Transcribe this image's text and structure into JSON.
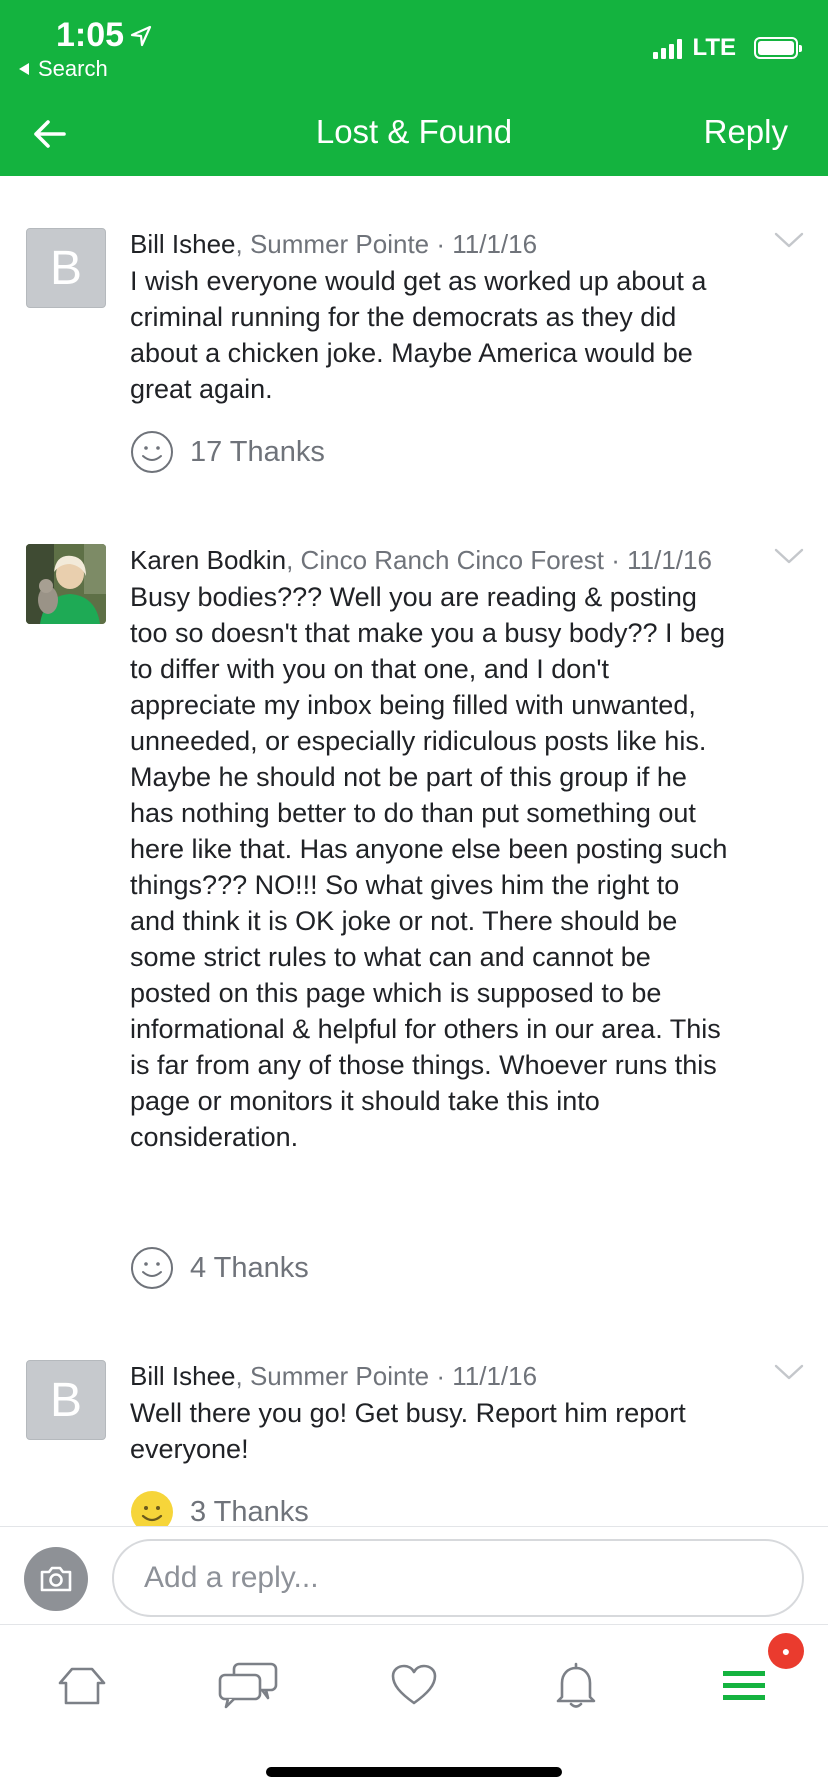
{
  "status_bar": {
    "time": "1:05",
    "back_app": "Search",
    "network": "LTE"
  },
  "nav": {
    "title": "Lost & Found",
    "reply_label": "Reply"
  },
  "comments": [
    {
      "avatar_letter": "B",
      "author": "Bill Ishee",
      "neighborhood": ", Summer Pointe · 11/1/16",
      "text": "I wish everyone would get as worked up about a criminal running for the democrats as they did about a chicken joke. Maybe America would be great again.",
      "thanks": "17 Thanks"
    },
    {
      "avatar_letter": "",
      "author": "Karen Bodkin",
      "neighborhood": ", Cinco Ranch Cinco Forest · 11/1/16",
      "text": "Busy bodies???  Well you are reading & posting too so doesn't that make you a busy body??  I beg to differ with you on that one, and I don't appreciate my inbox being filled with unwanted, unneeded, or especially ridiculous posts like his.  Maybe he should not be part of this group if he has nothing better to do than put something out here like that.  Has anyone else been posting such things??? NO!!!  So what gives him the right to and think it is OK joke or not.  There should be some strict rules to what can and cannot be posted on this page which is supposed to be informational & helpful for others in our area.  This is far from any of those things.  Whoever runs this page or monitors it should take this into consideration.",
      "thanks": "4 Thanks"
    },
    {
      "avatar_letter": "B",
      "author": "Bill Ishee",
      "neighborhood": ", Summer Pointe · 11/1/16",
      "text": "Well there you go! Get busy. Report him report everyone!",
      "thanks": "3 Thanks"
    }
  ],
  "reply_bar": {
    "placeholder": "Add a reply..."
  },
  "tab_bar": {
    "icons": [
      "home-icon",
      "messages-icon",
      "heart-icon",
      "bell-icon",
      "menu-icon"
    ]
  },
  "colors": {
    "brand_green": "#14b33f",
    "badge_red": "#ea3b2e",
    "thanked_yellow": "#f6d53a"
  }
}
